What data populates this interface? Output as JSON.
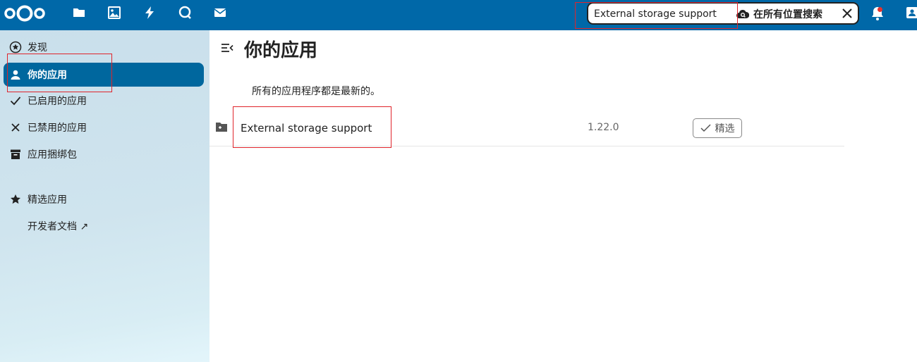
{
  "header": {
    "nav_icons": [
      "files-icon",
      "photos-icon",
      "activity-icon",
      "talk-icon",
      "mail-icon"
    ],
    "search": {
      "value": "External storage support",
      "search_everywhere_label": "在所有位置搜索"
    }
  },
  "sidebar": {
    "items": [
      {
        "label": "发现",
        "icon": "star-circle-icon",
        "active": false
      },
      {
        "label": "你的应用",
        "icon": "user-icon",
        "active": true
      },
      {
        "label": "已启用的应用",
        "icon": "check-icon",
        "active": false
      },
      {
        "label": "已禁用的应用",
        "icon": "close-icon",
        "active": false
      },
      {
        "label": "应用捆绑包",
        "icon": "archive-icon",
        "active": false
      }
    ],
    "featured": {
      "label": "精选应用",
      "icon": "star-icon"
    },
    "developer_docs": {
      "label": "开发者文档 ↗"
    }
  },
  "main": {
    "title": "你的应用",
    "notice": "所有的应用程序都是最新的。",
    "apps": [
      {
        "name": "External storage support",
        "version": "1.22.0",
        "badge": "精选"
      }
    ]
  },
  "colors": {
    "header_bg": "#0068a8",
    "active_item_bg": "#00679e",
    "annotation": "#e0242b"
  }
}
